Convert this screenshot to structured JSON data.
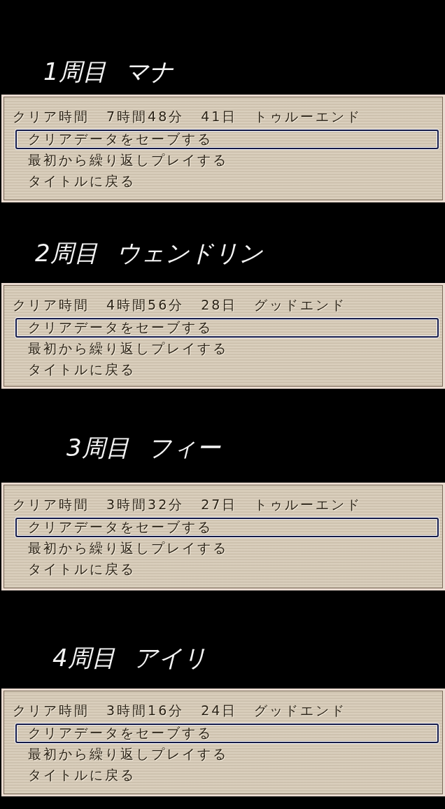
{
  "sections": [
    {
      "note": {
        "lap": "1周目",
        "name": "マナ"
      },
      "record": {
        "label": "クリア時間",
        "time": "7時間48分",
        "days": "41日",
        "ending": "トゥルーエンド"
      },
      "menu": [
        {
          "label": "クリアデータをセーブする",
          "selected": true
        },
        {
          "label": "最初から繰り返しプレイする",
          "selected": false
        },
        {
          "label": "タイトルに戻る",
          "selected": false
        }
      ]
    },
    {
      "note": {
        "lap": "2周目",
        "name": "ウェンドリン"
      },
      "record": {
        "label": "クリア時間",
        "time": "4時間56分",
        "days": "28日",
        "ending": "グッドエンド"
      },
      "menu": [
        {
          "label": "クリアデータをセーブする",
          "selected": true
        },
        {
          "label": "最初から繰り返しプレイする",
          "selected": false
        },
        {
          "label": "タイトルに戻る",
          "selected": false
        }
      ]
    },
    {
      "note": {
        "lap": "3周目",
        "name": "フィー"
      },
      "record": {
        "label": "クリア時間",
        "time": "3時間32分",
        "days": "27日",
        "ending": "トゥルーエンド"
      },
      "menu": [
        {
          "label": "クリアデータをセーブする",
          "selected": true
        },
        {
          "label": "最初から繰り返しプレイする",
          "selected": false
        },
        {
          "label": "タイトルに戻る",
          "selected": false
        }
      ]
    },
    {
      "note": {
        "lap": "4周目",
        "name": "アイリ"
      },
      "record": {
        "label": "クリア時間",
        "time": "3時間16分",
        "days": "24日",
        "ending": "グッドエンド"
      },
      "menu": [
        {
          "label": "クリアデータをセーブする",
          "selected": true
        },
        {
          "label": "最初から繰り返しプレイする",
          "selected": false
        },
        {
          "label": "タイトルに戻る",
          "selected": false
        }
      ]
    }
  ]
}
